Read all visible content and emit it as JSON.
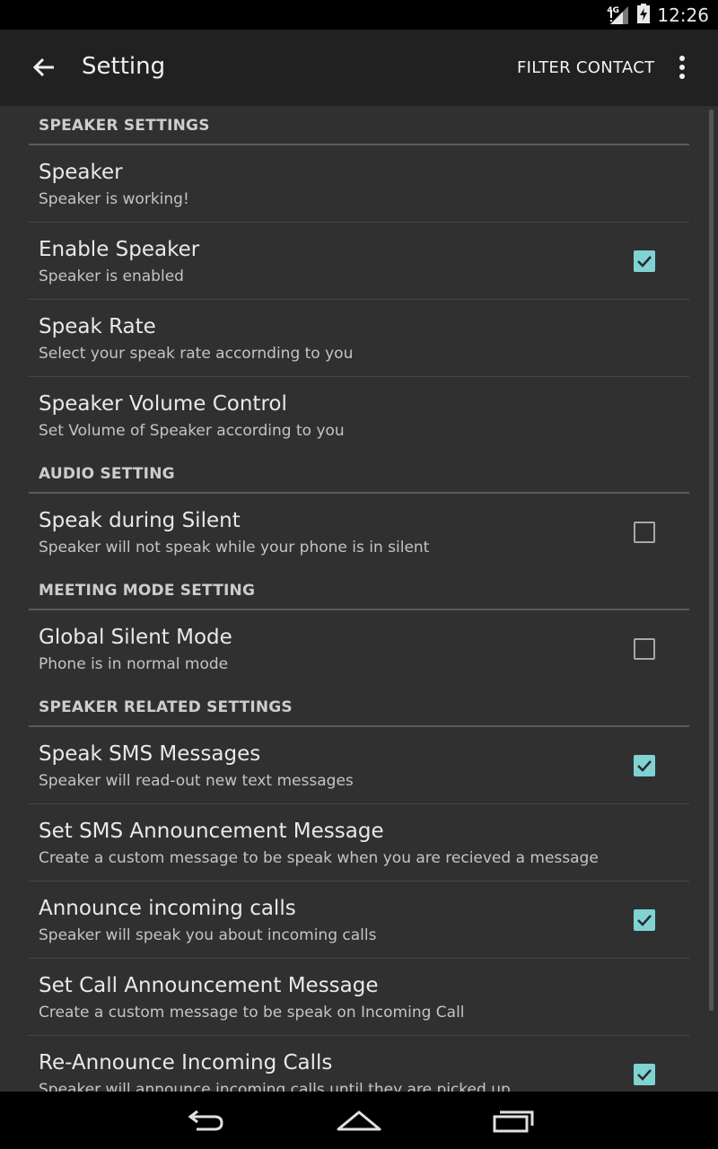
{
  "status_bar": {
    "network": "4G",
    "time": "12:26"
  },
  "action_bar": {
    "title": "Setting",
    "filter_label": "FILTER CONTACT"
  },
  "accent_color": "#7fd3d3",
  "categories": {
    "speaker_settings": "SPEAKER SETTINGS",
    "audio_setting": "AUDIO SETTING",
    "meeting_mode_setting": "MEETING MODE SETTING",
    "speaker_related_settings": "SPEAKER RELATED SETTINGS"
  },
  "prefs": {
    "speaker": {
      "title": "Speaker",
      "summary": "Speaker is working!"
    },
    "enable_speaker": {
      "title": "Enable Speaker",
      "summary": "Speaker is enabled",
      "checked": true
    },
    "speak_rate": {
      "title": "Speak Rate",
      "summary": "Select your speak rate accornding to you"
    },
    "speaker_volume": {
      "title": "Speaker Volume Control",
      "summary": "Set Volume of Speaker according to you"
    },
    "speak_during_silent": {
      "title": "Speak during Silent",
      "summary": "Speaker will not speak while your phone is in silent",
      "checked": false
    },
    "global_silent_mode": {
      "title": "Global Silent Mode",
      "summary": "Phone is in normal mode",
      "checked": false
    },
    "speak_sms": {
      "title": "Speak SMS Messages",
      "summary": "Speaker will read-out new text messages",
      "checked": true
    },
    "sms_announcement": {
      "title": "Set SMS Announcement Message",
      "summary": "Create a custom message to be speak when you are recieved a message"
    },
    "announce_calls": {
      "title": "Announce incoming calls",
      "summary": "Speaker will speak you about incoming calls",
      "checked": true
    },
    "call_announcement": {
      "title": "Set Call Announcement Message",
      "summary": "Create a custom message to be speak on Incoming Call"
    },
    "reannounce_calls": {
      "title": "Re-Announce Incoming Calls",
      "summary": "Speaker will announce incoming calls until they are picked up",
      "checked": true
    }
  },
  "nav_icons": [
    "back-nav-icon",
    "home-nav-icon",
    "recents-nav-icon"
  ]
}
